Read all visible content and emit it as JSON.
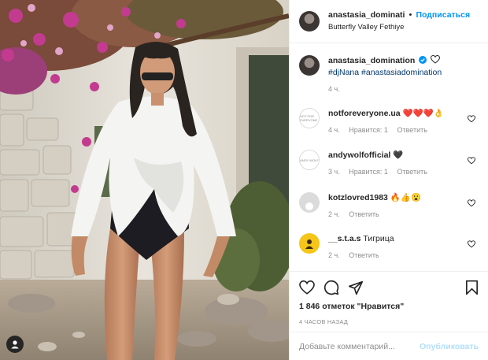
{
  "post": {
    "username": "anastasia_dominati",
    "separator": "•",
    "follow_label": "Подписаться",
    "location": "Butterfly Valley Fethiye"
  },
  "caption": {
    "username": "anastasia_domination",
    "tags": "#djNana #anastasiadomination",
    "time": "4 ч."
  },
  "comments": [
    {
      "username": "notforeveryone.ua",
      "text": "❤️❤️❤️👌",
      "time": "4 ч.",
      "likes": "Нравится: 1",
      "reply": "Ответить",
      "avatar": "brand-logo",
      "avatar_text": "NOT FOR EVERYONE"
    },
    {
      "username": "andywolfofficial",
      "text": "🖤",
      "time": "3 ч.",
      "likes": "Нравится: 1",
      "reply": "Ответить",
      "avatar": "brand-logo",
      "avatar_text": "ANDY WOLF"
    },
    {
      "username": "kotzlovred1983",
      "text": "🔥👍😮",
      "time": "2 ч.",
      "likes": "",
      "reply": "Ответить",
      "avatar": "default-avatar"
    },
    {
      "username": "__s.t.a.s",
      "text": "Тигрица",
      "time": "2 ч.",
      "likes": "",
      "reply": "Ответить",
      "avatar": "yellow-avatar"
    }
  ],
  "actions": {
    "like_icon": "heart-icon",
    "comment_icon": "comment-icon",
    "share_icon": "share-icon",
    "save_icon": "bookmark-icon"
  },
  "likes_count": "1 846 отметок \"Нравится\"",
  "posted_ago": "4 часов назад",
  "add_comment": {
    "placeholder": "Добавьте комментарий...",
    "post_label": "Опубликовать"
  },
  "colors": {
    "link_blue": "#0095f6",
    "tag_blue": "#00376b",
    "muted": "#8e8e8e",
    "border": "#efefef",
    "verified": "#0095f6",
    "post_disabled": "#b2dffc"
  }
}
